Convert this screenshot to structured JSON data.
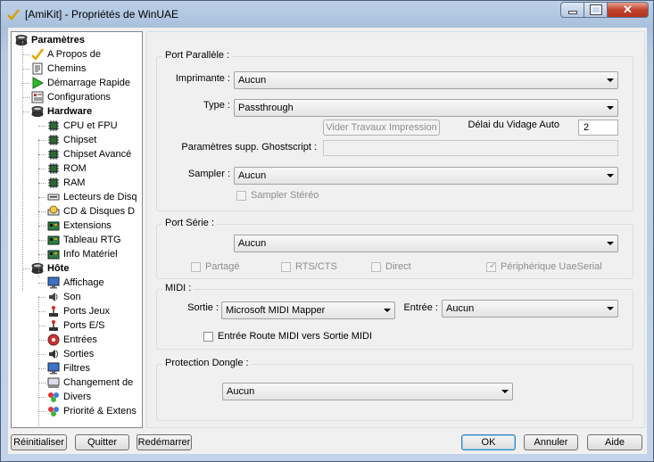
{
  "window": {
    "title": "[AmiKit] - Propriétés de WinUAE"
  },
  "colors": {
    "accent": "#3c7fb1",
    "close_button": "#c4432e",
    "disabled_text": "#8d8d8d"
  },
  "tree": {
    "root": "Paramètres",
    "items": [
      {
        "label": "A Propos de",
        "icon": "check-icon"
      },
      {
        "label": "Chemins",
        "icon": "document-icon"
      },
      {
        "label": "Démarrage Rapide",
        "icon": "play-icon"
      },
      {
        "label": "Configurations",
        "icon": "config-icon"
      },
      {
        "label": "Hardware",
        "icon": "disk-icon",
        "bold": true
      },
      {
        "label": "CPU et FPU",
        "icon": "chip-icon"
      },
      {
        "label": "Chipset",
        "icon": "chip-icon"
      },
      {
        "label": "Chipset Avancé",
        "icon": "chip-icon"
      },
      {
        "label": "ROM",
        "icon": "chip-icon"
      },
      {
        "label": "RAM",
        "icon": "chip-icon"
      },
      {
        "label": "Lecteurs de Disq",
        "icon": "floppy-drive-icon"
      },
      {
        "label": "CD & Disques D",
        "icon": "cd-drive-icon"
      },
      {
        "label": "Extensions",
        "icon": "board-icon"
      },
      {
        "label": "Tableau RTG",
        "icon": "board-icon"
      },
      {
        "label": "Info Matériel",
        "icon": "board-icon"
      },
      {
        "label": "Hôte",
        "icon": "disk-icon",
        "bold": true
      },
      {
        "label": "Affichage",
        "icon": "monitor-icon"
      },
      {
        "label": "Son",
        "icon": "speaker-icon"
      },
      {
        "label": "Ports Jeux",
        "icon": "joystick-icon"
      },
      {
        "label": "Ports E/S",
        "icon": "joystick-icon"
      },
      {
        "label": "Entrées",
        "icon": "input-icon"
      },
      {
        "label": "Sorties",
        "icon": "output-icon"
      },
      {
        "label": "Filtres",
        "icon": "monitor-icon"
      },
      {
        "label": "Changement de",
        "icon": "drive-icon"
      },
      {
        "label": "Divers",
        "icon": "misc-icon"
      },
      {
        "label": "Priorité & Extens",
        "icon": "misc-icon"
      }
    ]
  },
  "parallel": {
    "group_title": "Port Parallèle :",
    "printer_label": "Imprimante :",
    "printer_value": "Aucun",
    "type_label": "Type :",
    "type_value": "Passthrough",
    "flush_button": "Vider Travaux Impression",
    "flush_delay_label": "Délai du Vidage Auto",
    "flush_delay_value": "2",
    "ghostscript_label": "Paramètres supp. Ghostscript :",
    "ghostscript_value": "",
    "sampler_label": "Sampler :",
    "sampler_value": "Aucun",
    "sampler_stereo": "Sampler Stéréo"
  },
  "serial": {
    "group_title": "Port Série :",
    "port_value": "Aucun",
    "shared": "Partagé",
    "rts_cts": "RTS/CTS",
    "direct": "Direct",
    "uae_serial": "Périphérique UaeSerial"
  },
  "midi": {
    "group_title": "MIDI :",
    "out_label": "Sortie :",
    "out_value": "Microsoft MIDI Mapper",
    "in_label": "Entrée :",
    "in_value": "Aucun",
    "route": "Entrée Route MIDI vers Sortie MIDI"
  },
  "dongle": {
    "group_title": "Protection Dongle :",
    "value": "Aucun"
  },
  "footer": {
    "reset": "Réinitialiser",
    "quit": "Quitter",
    "restart": "Redémarrer",
    "ok": "OK",
    "cancel": "Annuler",
    "help": "Aide"
  }
}
